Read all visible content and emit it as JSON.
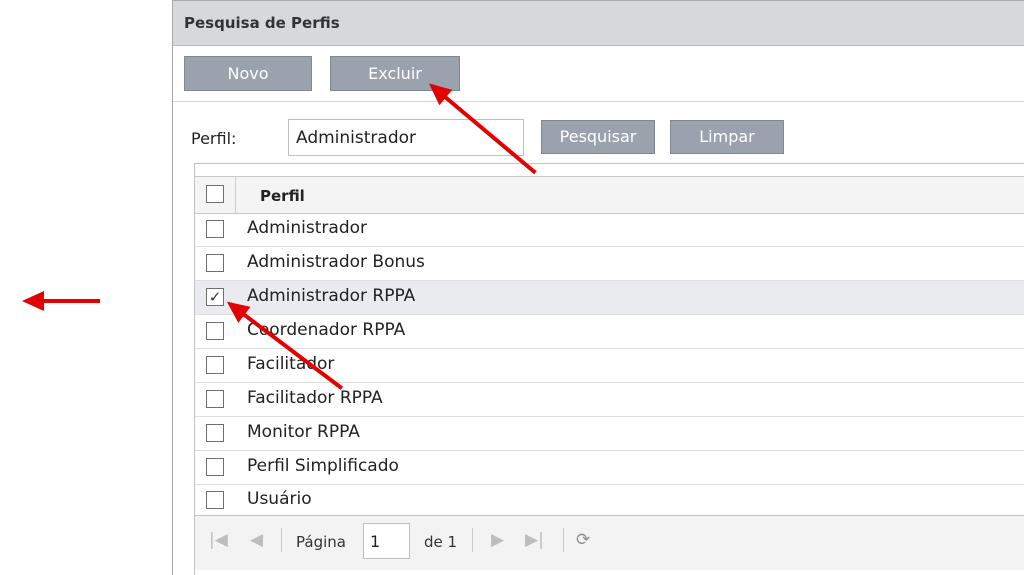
{
  "panel": {
    "title": "Pesquisa de Perfis"
  },
  "toolbar": {
    "novo_label": "Novo",
    "excluir_label": "Excluir"
  },
  "filter": {
    "label": "Perfil:",
    "value": "Administrador",
    "pesquisar_label": "Pesquisar",
    "limpar_label": "Limpar"
  },
  "grid": {
    "header": "Perfil",
    "rows": [
      {
        "label": "Administrador",
        "checked": false
      },
      {
        "label": "Administrador Bonus",
        "checked": false
      },
      {
        "label": "Administrador RPPA",
        "checked": true
      },
      {
        "label": "Coordenador RPPA",
        "checked": false
      },
      {
        "label": "Facilitador",
        "checked": false
      },
      {
        "label": "Facilitador RPPA",
        "checked": false
      },
      {
        "label": "Monitor RPPA",
        "checked": false
      },
      {
        "label": "Perfil Simplificado",
        "checked": false
      },
      {
        "label": "Usuário",
        "checked": false
      }
    ]
  },
  "pager": {
    "page_label": "Página",
    "page_value": "1",
    "of_label": "de 1"
  },
  "check_glyph": "✓",
  "colors": {
    "annotation_arrow": "#e30000",
    "button": "#9aa3ad",
    "selected_row": "#e9ebef"
  },
  "icons": [
    "first-page-icon",
    "prev-page-icon",
    "next-page-icon",
    "last-page-icon",
    "refresh-icon",
    "annotation-arrow-icon"
  ]
}
